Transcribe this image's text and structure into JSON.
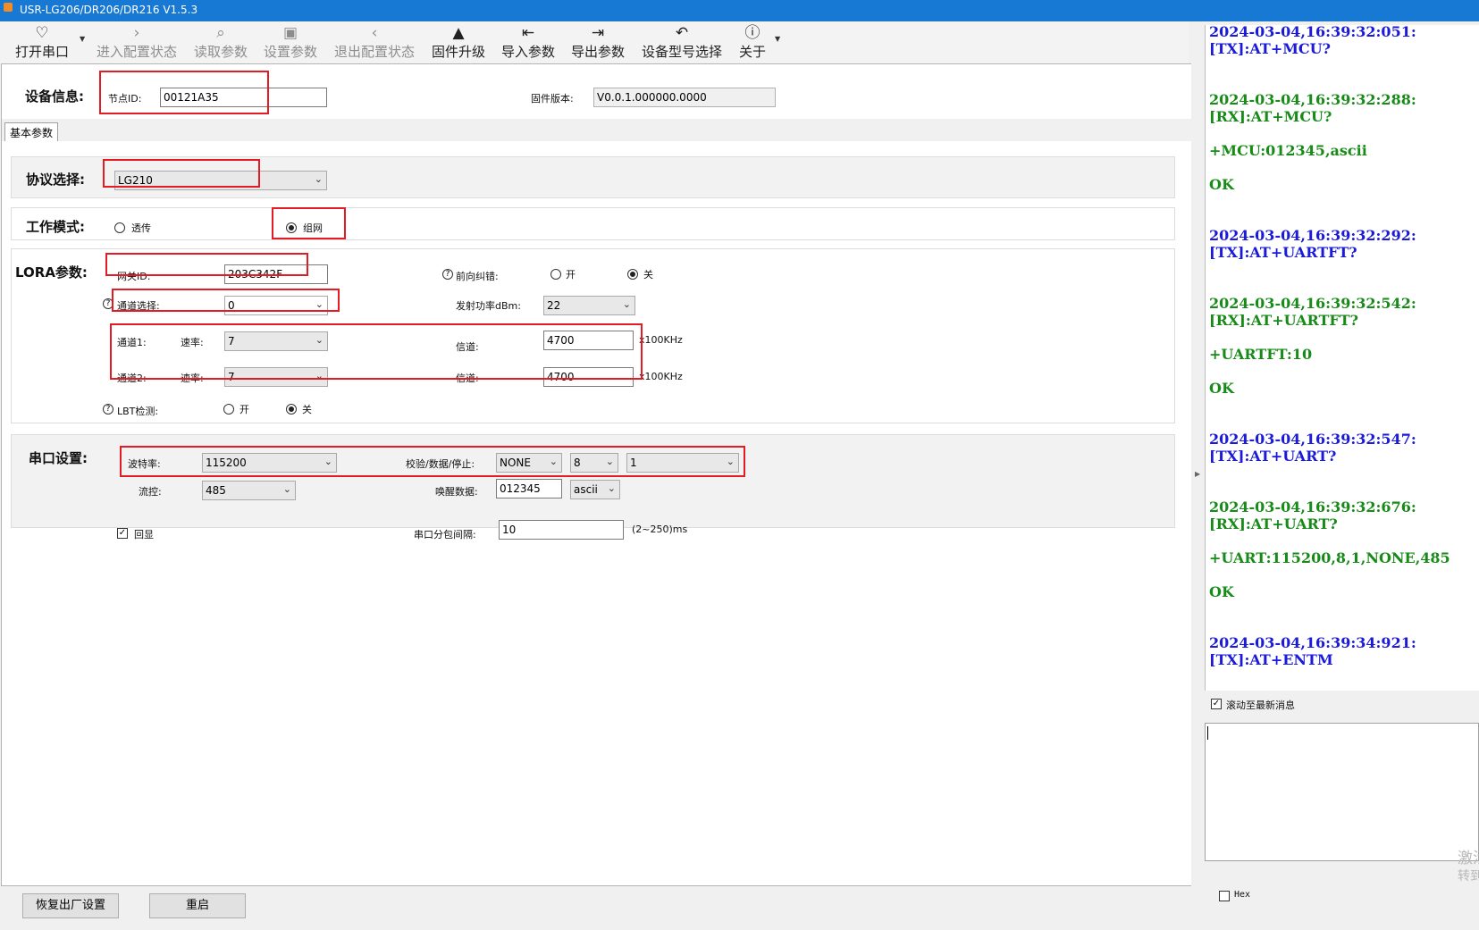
{
  "window": {
    "title": "USR-LG206/DR206/DR216 V1.5.3"
  },
  "toolbar": {
    "open_port": "打开串口",
    "enter_config": "进入配置状态",
    "read_params": "读取参数",
    "set_params": "设置参数",
    "exit_config": "退出配置状态",
    "firmware_upgrade": "固件升级",
    "import_params": "导入参数",
    "export_params": "导出参数",
    "device_model": "设备型号选择",
    "about": "关于"
  },
  "device_info": {
    "title": "设备信息:",
    "node_id_label": "节点ID:",
    "node_id_value": "00121A35",
    "firmware_label": "固件版本:",
    "firmware_value": "V0.0.1.000000.0000"
  },
  "tabs": {
    "basic": "基本参数"
  },
  "protocol": {
    "title": "协议选择:",
    "value": "LG210"
  },
  "work_mode": {
    "title": "工作模式:",
    "option_transparent": "透传",
    "option_network": "组网",
    "selected": "组网"
  },
  "lora": {
    "title": "LORA参数:",
    "gateway_id_label": "网关ID:",
    "gateway_id_value": "203C342F",
    "fec_label": "前向纠错:",
    "fec_on": "开",
    "fec_off": "关",
    "fec_selected": "关",
    "channel_select_label": "通道选择:",
    "channel_select_value": "0",
    "tx_power_label": "发射功率dBm:",
    "tx_power_value": "22",
    "channel1_label": "通道1:",
    "channel2_label": "通道2:",
    "rate_label": "速率:",
    "channel1_rate": "7",
    "channel2_rate": "7",
    "freq_label": "信道:",
    "channel1_freq": "4700",
    "channel2_freq": "4700",
    "freq_unit": "x100KHz",
    "lbt_label": "LBT检测:",
    "lbt_on": "开",
    "lbt_off": "关",
    "lbt_selected": "关"
  },
  "serial": {
    "title": "串口设置:",
    "baud_label": "波特率:",
    "baud_value": "115200",
    "check_label": "校验/数据/停止:",
    "parity_value": "NONE",
    "data_bits_value": "8",
    "stop_bits_value": "1",
    "flow_label": "流控:",
    "flow_value": "485",
    "wake_label": "唤醒数据:",
    "wake_value": "012345",
    "wake_format": "ascii",
    "echo_label": "回显",
    "echo_checked": true,
    "interval_label": "串口分包间隔:",
    "interval_value": "10",
    "interval_range": "(2~250)ms"
  },
  "buttons": {
    "factory_reset": "恢复出厂设置",
    "restart": "重启"
  },
  "log": {
    "lines": [
      "2024-03-04,16:39:32:051:",
      "[TX]:AT+MCU?",
      "2024-03-04,16:39:32:288:",
      "[RX]:AT+MCU?",
      "+MCU:012345,ascii",
      "OK",
      "2024-03-04,16:39:32:292:",
      "[TX]:AT+UARTFT?",
      "2024-03-04,16:39:32:542:",
      "[RX]:AT+UARTFT?",
      "+UARTFT:10",
      "OK",
      "2024-03-04,16:39:32:547:",
      "[TX]:AT+UART?",
      "2024-03-04,16:39:32:676:",
      "[RX]:AT+UART?",
      "+UART:115200,8,1,NONE,485",
      "OK",
      "2024-03-04,16:39:34:921:",
      "[TX]:AT+ENTM"
    ],
    "colors": {
      "tx": "#1a1ad8",
      "rx": "#178a17"
    }
  },
  "log_options": {
    "autoscroll_label": "滚动至最新消息",
    "autoscroll_checked": true,
    "hex_label": "Hex",
    "hex_checked": false
  },
  "watermark": {
    "line1": "激活",
    "line2": "转到"
  }
}
